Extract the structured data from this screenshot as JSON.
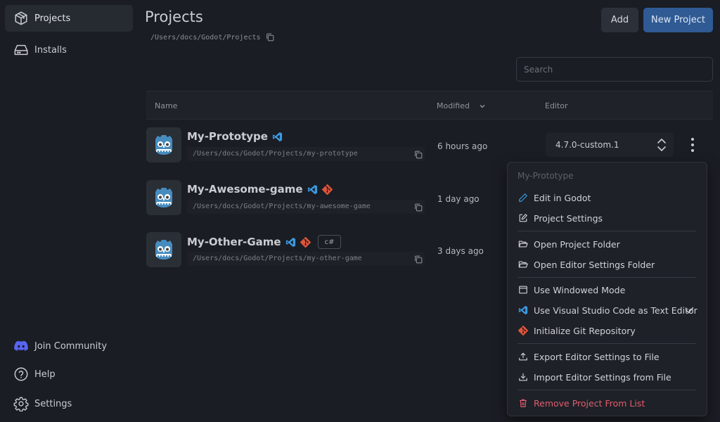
{
  "sidebar": {
    "nav": [
      {
        "label": "Projects",
        "icon": "package-icon",
        "active": true
      },
      {
        "label": "Installs",
        "icon": "hard-drive-icon",
        "active": false
      }
    ],
    "bottom": [
      {
        "label": "Join Community",
        "icon": "discord-icon"
      },
      {
        "label": "Help",
        "icon": "help-circle-icon"
      },
      {
        "label": "Settings",
        "icon": "gear-icon"
      }
    ]
  },
  "header": {
    "title": "Projects",
    "path": "/Users/docs/Godot/Projects",
    "add_label": "Add",
    "new_label": "New Project"
  },
  "search": {
    "placeholder": "Search",
    "value": ""
  },
  "table": {
    "columns": {
      "name": "Name",
      "modified": "Modified",
      "editor": "Editor"
    },
    "rows": [
      {
        "name": "My-Prototype",
        "path": "/Users/docs/Godot/Projects/my-prototype",
        "modified": "6 hours ago",
        "vscode": true,
        "git": false,
        "csharp": false
      },
      {
        "name": "My-Awesome-game",
        "path": "/Users/docs/Godot/Projects/my-awesome-game",
        "modified": "1 day ago",
        "vscode": true,
        "git": true,
        "csharp": false
      },
      {
        "name": "My-Other-Game",
        "path": "/Users/docs/Godot/Projects/my-other-game",
        "modified": "3 days ago",
        "vscode": true,
        "git": true,
        "csharp": true,
        "csharp_label": "c#"
      }
    ],
    "editor_version": "4.7.0-custom.1"
  },
  "menu": {
    "title": "My-Prototype",
    "items": [
      {
        "label": "Edit in Godot",
        "icon": "pencil-icon"
      },
      {
        "label": "Project Settings",
        "icon": "edit-square-icon"
      },
      {
        "label": "Open Project Folder",
        "icon": "folder-open-icon"
      },
      {
        "label": "Open Editor Settings Folder",
        "icon": "folder-open-icon"
      },
      {
        "label": "Use Windowed Mode",
        "icon": "window-icon"
      },
      {
        "label": "Use Visual Studio Code as Text Editor",
        "icon": "vscode-icon",
        "checked": true
      },
      {
        "label": "Initialize Git Repository",
        "icon": "git-icon"
      },
      {
        "label": "Export Editor Settings to File",
        "icon": "upload-icon"
      },
      {
        "label": "Import Editor Settings from File",
        "icon": "download-icon"
      },
      {
        "label": "Remove Project From List",
        "icon": "trash-icon"
      }
    ]
  },
  "colors": {
    "accent": "#2f5a94",
    "vscode": "#3b9ae1",
    "git": "#e0553a",
    "danger": "#e05d6f",
    "discord": "#5865f2"
  }
}
